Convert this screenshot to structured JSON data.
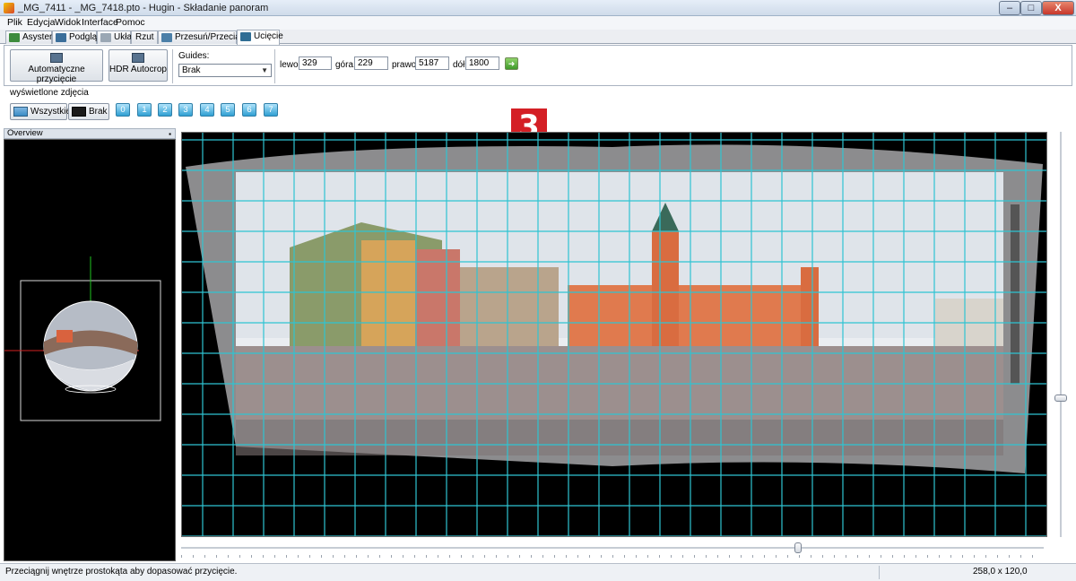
{
  "window": {
    "title": "_MG_7411 - _MG_7418.pto - Hugin - Składanie panoram",
    "minimize": "–",
    "maximize": "□",
    "close": "X"
  },
  "menu": [
    "Plik",
    "Edycja",
    "Widok",
    "Interface",
    "Pomoc"
  ],
  "tabs": [
    {
      "label": "Asystent",
      "icon": "wizard-icon"
    },
    {
      "label": "Podgląd",
      "icon": "preview-icon"
    },
    {
      "label": "Układ",
      "icon": "layout-icon"
    },
    {
      "label": "Rzut",
      "icon": ""
    },
    {
      "label": "Przesuń/Przeciągnij",
      "icon": "move-icon"
    },
    {
      "label": "Ucięcie",
      "icon": "crop-icon",
      "active": true
    }
  ],
  "toolbar": {
    "auto_crop_label": "Automatyczne przycięcie",
    "hdr_autocrop_label": "HDR Autocrop",
    "guides_label": "Guides:",
    "guides_value": "Brak",
    "left_label": "lewo:",
    "left_value": "329",
    "top_label": "góra:",
    "top_value": "229",
    "right_label": "prawo:",
    "right_value": "5187",
    "bottom_label": "dół:",
    "bottom_value": "1800"
  },
  "displayed": {
    "label": "wyświetlone zdjęcia",
    "all_label": "Wszystkie",
    "none_label": "Brak",
    "images": [
      "0",
      "1",
      "2",
      "3",
      "4",
      "5",
      "6",
      "7"
    ]
  },
  "badge": "3",
  "overview": {
    "title": "Overview"
  },
  "status": {
    "message": "Przeciągnij wnętrze prostokąta aby dopasować przycięcie.",
    "size": "258,0 x 120,0"
  },
  "scroll": {
    "horizontal_position": 0.71,
    "vertical_position": 0.66
  },
  "colors": {
    "grid": "#2fc4d2",
    "badge": "#d41f25",
    "crop_overlay": "#ffffff"
  }
}
